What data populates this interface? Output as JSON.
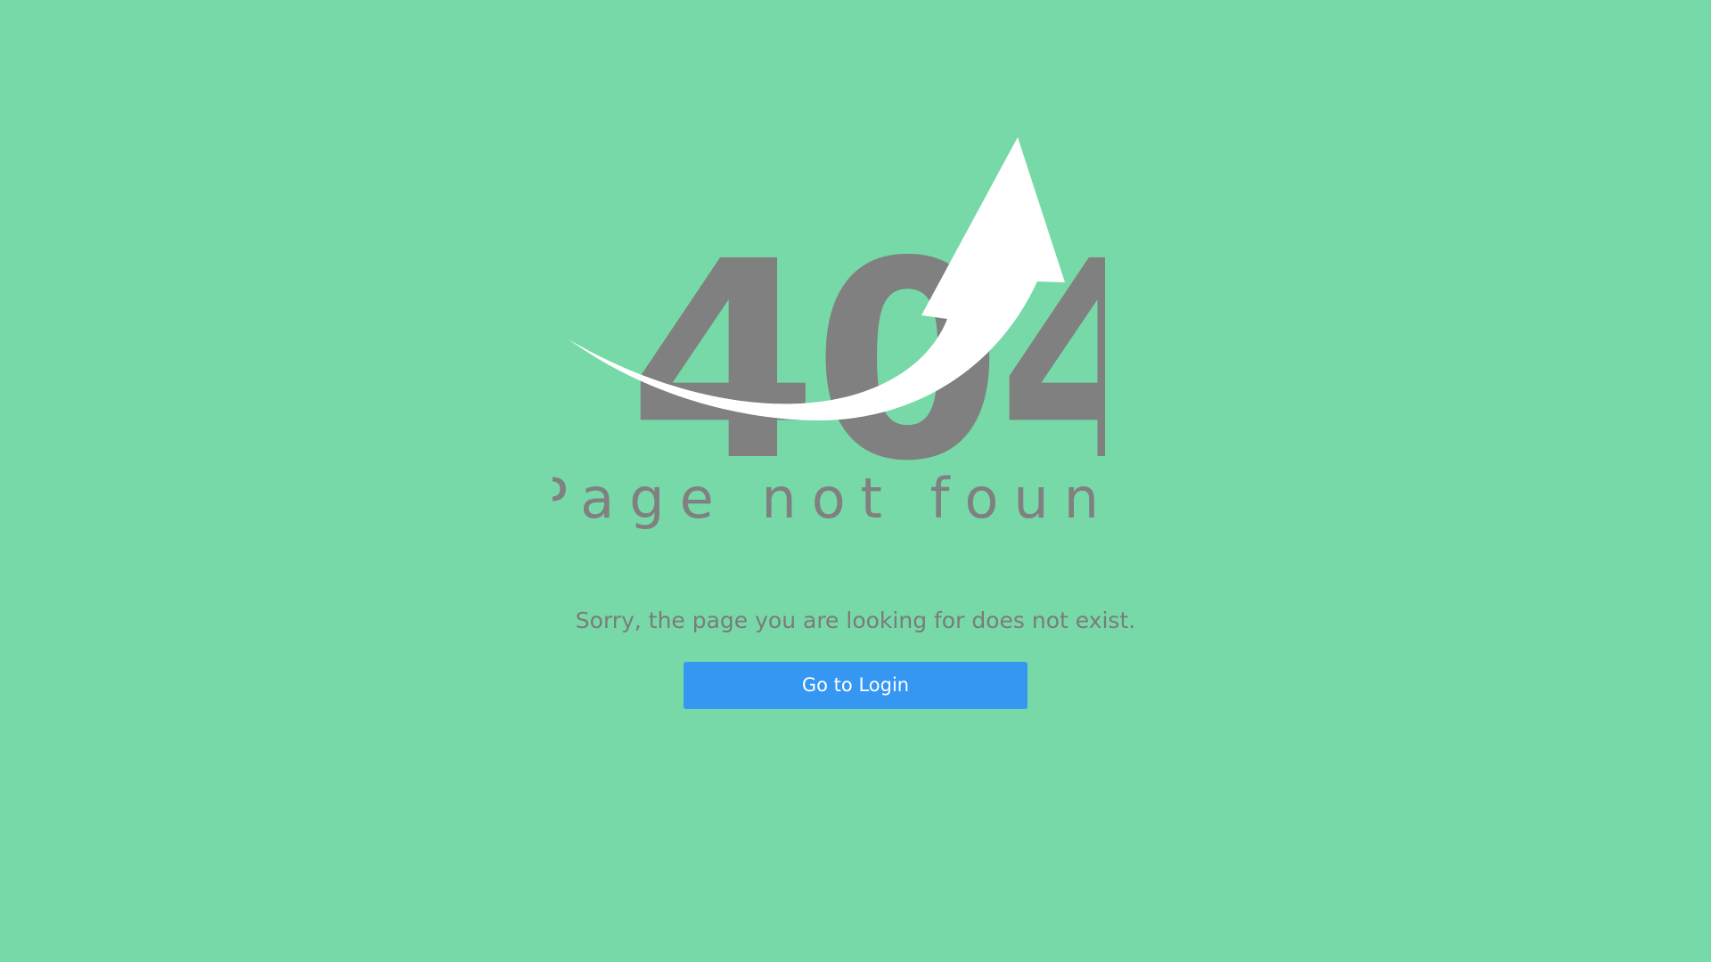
{
  "error": {
    "code": "404",
    "title": "Page not found",
    "message": "Sorry, the page you are looking for does not exist."
  },
  "actions": {
    "login_label": "Go to Login"
  },
  "colors": {
    "background": "#77d9a7",
    "text": "#808080",
    "button": "#3597f2",
    "arrow": "#ffffff"
  },
  "icons": {
    "illustration": "upward-curved-arrow-icon"
  }
}
